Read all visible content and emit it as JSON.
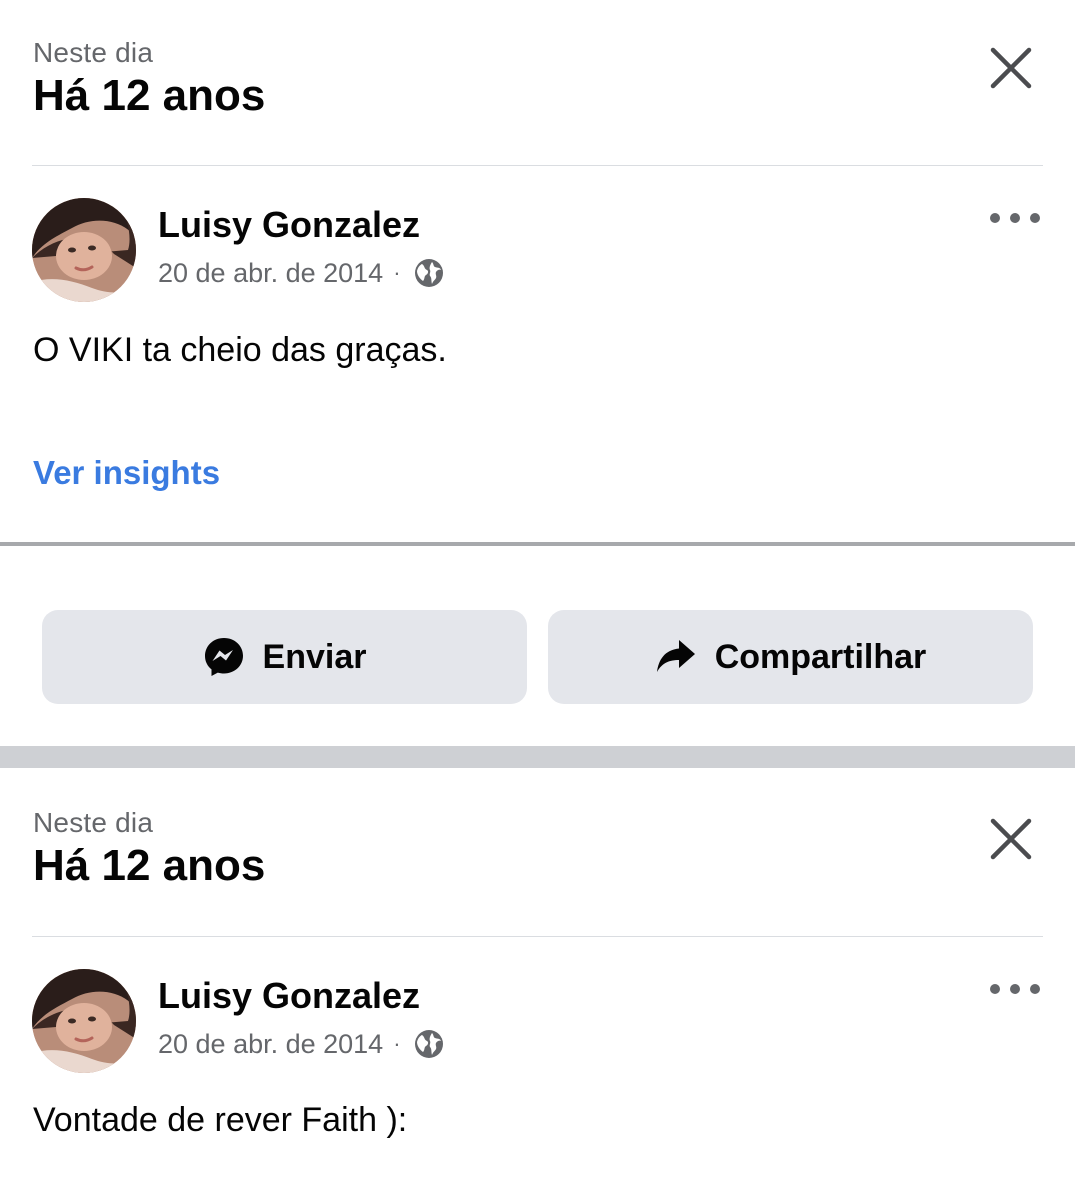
{
  "memories": [
    {
      "eyebrow": "Neste dia",
      "title": "Há 12 anos",
      "post": {
        "author": "Luisy Gonzalez",
        "date": "20 de abr. de 2014",
        "separator": "·",
        "privacy_icon": "globe-icon",
        "text": "O VIKI ta cheio das graças."
      },
      "insights_link": "Ver insights"
    },
    {
      "eyebrow": "Neste dia",
      "title": "Há 12 anos",
      "post": {
        "author": "Luisy Gonzalez",
        "date": "20 de abr. de 2014",
        "separator": "·",
        "privacy_icon": "globe-icon",
        "text": "Vontade de rever Faith ):"
      }
    }
  ],
  "actions": {
    "send_label": "Enviar",
    "send_icon": "messenger-icon",
    "share_label": "Compartilhar",
    "share_icon": "share-arrow-icon"
  },
  "colors": {
    "link_blue": "#3a7be0",
    "secondary_text": "#65676b",
    "button_bg": "#e4e6eb",
    "divider": "#ced0d4"
  }
}
